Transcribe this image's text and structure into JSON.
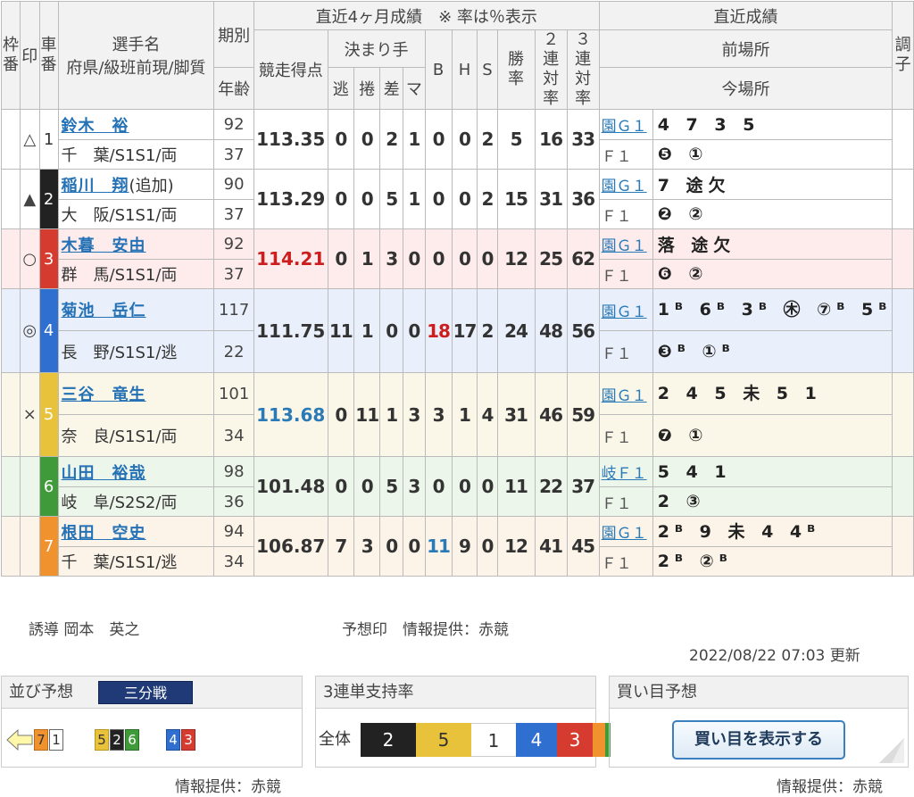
{
  "headers": {
    "waku": "枠番",
    "mark": "印",
    "car": "車番",
    "player": "選手名",
    "player_sub": "府県/級班前現/脚質",
    "term": "期別",
    "age": "年齢",
    "recent4": "直近4ヶ月成績　※ 率は％表示",
    "score": "競走得点",
    "kimarite": "決まり手",
    "nige": "逃",
    "makuri": "捲",
    "sashi": "差",
    "mark_k": "マ",
    "b": "B",
    "h": "H",
    "s": "S",
    "win": "勝率",
    "ren2": "２連対率",
    "ren3": "３連対率",
    "recent": "直近成績",
    "prev": "前場所",
    "now": "今場所",
    "cond": "調子"
  },
  "riders": [
    {
      "mark": "△",
      "num": "1",
      "name": "鈴木　裕",
      "suffix": "",
      "pref": "千　葉/S1S1/両",
      "term": "92",
      "age": "37",
      "score": "113.35",
      "nige": "0",
      "makuri": "0",
      "sashi": "2",
      "mk": "1",
      "b": "0",
      "h": "0",
      "s": "2",
      "win": "5",
      "ren2": "16",
      "ren3": "33",
      "prev_venue": "園Ｇ１",
      "prev_res": "4 7 3 5",
      "now_venue": "Ｆ１",
      "now_res": "❺ ①"
    },
    {
      "mark": "▲",
      "num": "2",
      "name": "稲川　翔",
      "suffix": "(追加)",
      "pref": "大　阪/S1S1/両",
      "term": "90",
      "age": "37",
      "score": "113.29",
      "nige": "0",
      "makuri": "0",
      "sashi": "5",
      "mk": "1",
      "b": "0",
      "h": "0",
      "s": "2",
      "win": "15",
      "ren2": "31",
      "ren3": "36",
      "prev_venue": "園Ｇ１",
      "prev_res": "7 途欠",
      "now_venue": "Ｆ１",
      "now_res": "❷ ②"
    },
    {
      "mark": "○",
      "num": "3",
      "name": "木暮　安由",
      "suffix": "",
      "pref": "群　馬/S1S1/両",
      "term": "92",
      "age": "37",
      "score": "114.21",
      "nige": "0",
      "makuri": "1",
      "sashi": "3",
      "mk": "0",
      "b": "0",
      "h": "0",
      "s": "0",
      "win": "12",
      "ren2": "25",
      "ren3": "62",
      "prev_venue": "園Ｇ１",
      "prev_res": "落 途欠",
      "now_venue": "Ｆ１",
      "now_res": "❻ ②"
    },
    {
      "mark": "◎",
      "num": "4",
      "name": "菊池　岳仁",
      "suffix": "",
      "pref": "長　野/S1S1/逃",
      "term": "117",
      "age": "22",
      "score": "111.75",
      "nige": "11",
      "makuri": "1",
      "sashi": "0",
      "mk": "0",
      "b": "18",
      "h": "17",
      "s": "2",
      "win": "24",
      "ren2": "48",
      "ren3": "56",
      "prev_venue": "園Ｇ１",
      "prev_res": "1ᴮ 6ᴮ 3ᴮ ㊍ ⑦ᴮ 5ᴮ",
      "now_venue": "Ｆ１",
      "now_res": "❸ᴮ ①ᴮ"
    },
    {
      "mark": "×",
      "num": "5",
      "name": "三谷　竜生",
      "suffix": "",
      "pref": "奈　良/S1S1/両",
      "term": "101",
      "age": "34",
      "score": "113.68",
      "nige": "0",
      "makuri": "11",
      "sashi": "1",
      "mk": "3",
      "b": "3",
      "h": "1",
      "s": "4",
      "win": "31",
      "ren2": "46",
      "ren3": "59",
      "prev_venue": "園Ｇ１",
      "prev_res": "2 4 5 未 5 1",
      "now_venue": "Ｆ１",
      "now_res": "❼ ①"
    },
    {
      "mark": "",
      "num": "6",
      "name": "山田　裕哉",
      "suffix": "",
      "pref": "岐　阜/S2S2/両",
      "term": "98",
      "age": "36",
      "score": "101.48",
      "nige": "0",
      "makuri": "0",
      "sashi": "5",
      "mk": "3",
      "b": "0",
      "h": "0",
      "s": "0",
      "win": "11",
      "ren2": "22",
      "ren3": "37",
      "prev_venue": "岐Ｆ１",
      "prev_res": "5 4 1",
      "now_venue": "Ｆ１",
      "now_res": "2 ③"
    },
    {
      "mark": "",
      "num": "7",
      "name": "根田　空史",
      "suffix": "",
      "pref": "千　葉/S1S1/逃",
      "term": "94",
      "age": "34",
      "score": "106.87",
      "nige": "7",
      "makuri": "3",
      "sashi": "0",
      "mk": "0",
      "b": "11",
      "h": "9",
      "s": "0",
      "win": "12",
      "ren2": "41",
      "ren3": "45",
      "prev_venue": "園Ｇ１",
      "prev_res": "2ᴮ 9 未 4 4ᴮ",
      "now_venue": "Ｆ１",
      "now_res": "2ᴮ ②ᴮ"
    }
  ],
  "colors": {
    "car1": "#ffffff",
    "car2": "#222222",
    "car3": "#d63b2f",
    "car4": "#2f6fd0",
    "car5": "#e8c23a",
    "car6": "#3f9a3a",
    "car7": "#f0922e",
    "row3_bg": "#fdeceb",
    "row4_bg": "#eaf0fb",
    "row5_bg": "#fbf7e8",
    "row6_bg": "#edf6ea",
    "row7_bg": "#fcf4e8"
  },
  "footer": {
    "lead_label": "誘導",
    "lead_name": "岡本　英之",
    "mark_credit": "予想印　情報提供：赤競",
    "updated": "2022/08/22 07:03 更新"
  },
  "line_panel": {
    "title": "並び予想",
    "badge": "三分戦",
    "groups": [
      "7 1",
      "5 2 6",
      "4 3"
    ],
    "credit": "情報提供：赤競"
  },
  "support_panel": {
    "title": "3連単支持率",
    "label": "全体",
    "segments": [
      "2",
      "5",
      "1",
      "4",
      "3"
    ]
  },
  "buy_panel": {
    "title": "買い目予想",
    "button": "買い目を表示する",
    "credit": "情報提供：赤競"
  }
}
